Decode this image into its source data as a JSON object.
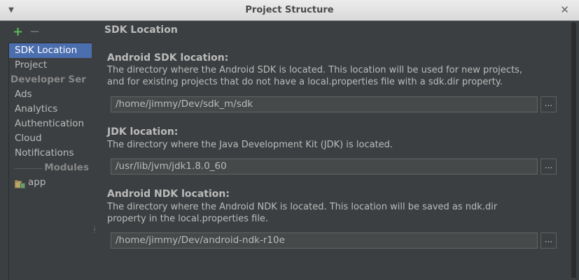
{
  "window": {
    "title": "Project Structure"
  },
  "sidebar": {
    "add_label": "+",
    "remove_label": "−",
    "items": [
      {
        "label": "SDK Location"
      },
      {
        "label": "Project"
      },
      {
        "label": "Developer Ser"
      },
      {
        "label": "Ads"
      },
      {
        "label": "Analytics"
      },
      {
        "label": "Authentication"
      },
      {
        "label": "Cloud"
      },
      {
        "label": "Notifications"
      },
      {
        "label": "Modules"
      },
      {
        "label": "app"
      }
    ]
  },
  "main": {
    "section_title": "SDK Location",
    "android_sdk": {
      "title": "Android SDK location:",
      "desc_line1": "The directory where the Android SDK is located. This location will be used for new projects,",
      "desc_line2": "and for existing projects that do not have a local.properties file with a sdk.dir property.",
      "value": "/home/jimmy/Dev/sdk_m/sdk",
      "browse_label": "..."
    },
    "jdk": {
      "title": "JDK location:",
      "desc_line1": "The directory where the Java Development Kit (JDK) is located.",
      "value": "/usr/lib/jvm/jdk1.8.0_60",
      "browse_label": "..."
    },
    "android_ndk": {
      "title": "Android NDK location:",
      "desc_line1": "The directory where the Android NDK is located. This location will be saved as ndk.dir",
      "desc_line2": "property in the local.properties file.",
      "value": "/home/jimmy/Dev/android-ndk-r10e",
      "browse_label": "..."
    }
  }
}
